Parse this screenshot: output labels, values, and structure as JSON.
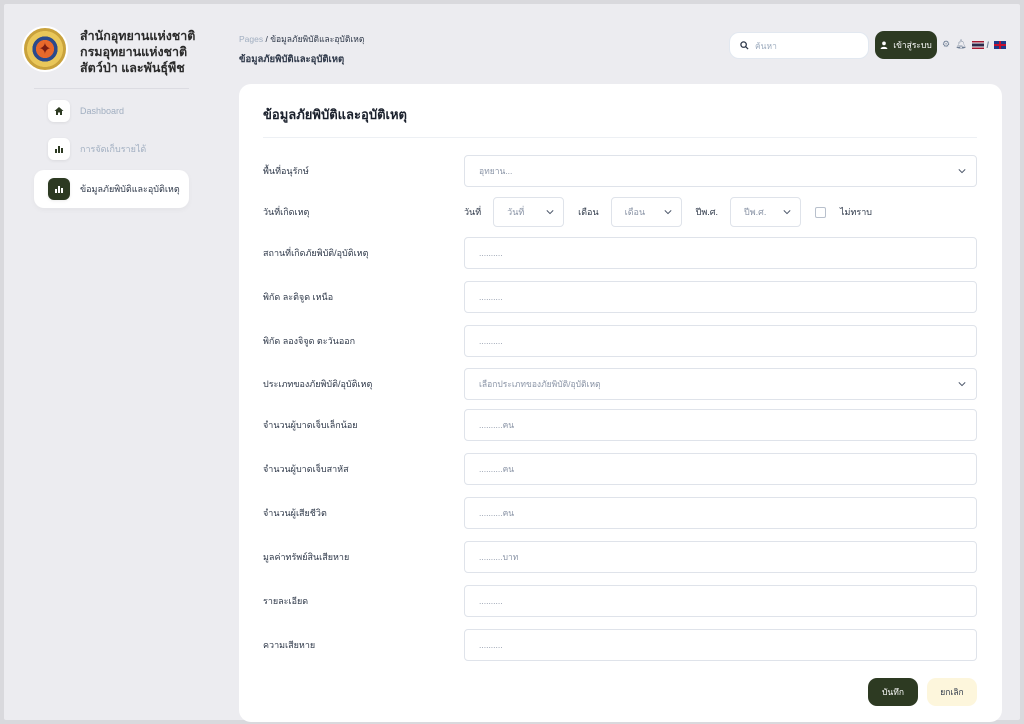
{
  "brand": {
    "logo_icon": "dept-seal-icon",
    "lines": [
      "สำนักอุทยานแห่งชาติ",
      "กรมอุทยานแห่งชาติ",
      "สัตว์ป่า และพันธุ์พืช"
    ]
  },
  "sidebar": {
    "items": [
      {
        "label": "Dashboard",
        "icon": "home-icon",
        "active": false
      },
      {
        "label": "การจัดเก็บรายได้",
        "icon": "bar-chart-icon",
        "active": false
      },
      {
        "label": "ข้อมูลภัยพิบัติและอุบัติเหตุ",
        "icon": "bar-chart-icon",
        "active": true
      }
    ]
  },
  "header": {
    "breadcrumb_root": "Pages",
    "breadcrumb_sep": "/",
    "breadcrumb_current": "ข้อมูลภัยพิบัติและอุบัติเหตุ",
    "page_title": "ข้อมูลภัยพิบัติและอุบัติเหตุ",
    "search_placeholder": "ค้นหา",
    "login_label": "เข้าสู่ระบบ",
    "lang_sep": "/"
  },
  "form": {
    "title": "ข้อมูลภัยพิบัติและอุบัติเหตุ",
    "park": {
      "label": "พื้นที่อนุรักษ์",
      "placeholder": "อุทยาน..."
    },
    "date": {
      "label": "วันที่เกิดเหตุ",
      "day_label": "วันที่",
      "day_value": "วันที่",
      "month_label": "เดือน",
      "month_value": "เดือน",
      "year_label": "ปีพ.ศ.",
      "year_value": "ปีพ.ศ.",
      "unknown_label": "ไม่ทราบ"
    },
    "location": {
      "label": "สถานที่เกิดภัยพิบัติ/อุบัติเหตุ",
      "placeholder": ".........."
    },
    "latitude": {
      "label": "พิกัด ละติจูด เหนือ",
      "placeholder": ".........."
    },
    "longitude": {
      "label": "พิกัด ลองจิจูด ตะวันออก",
      "placeholder": ".........."
    },
    "type": {
      "label": "ประเภทของภัยพิบัติ/อุบัติเหตุ",
      "placeholder": "เลือกประเภทของภัยพิบัติ/อุบัติเหตุ"
    },
    "minor_injured": {
      "label": "จำนวนผู้บาดเจ็บเล็กน้อย",
      "placeholder": "..........คน"
    },
    "serious_injured": {
      "label": "จำนวนผู้บาดเจ็บสาหัส",
      "placeholder": "..........คน"
    },
    "deaths": {
      "label": "จำนวนผู้เสียชีวิต",
      "placeholder": "..........คน"
    },
    "property_loss": {
      "label": "มูลค่าทรัพย์สินเสียหาย",
      "placeholder": "..........บาท"
    },
    "details": {
      "label": "รายละเอียด",
      "placeholder": ".........."
    },
    "damage": {
      "label": "ความเสียหาย",
      "placeholder": ".........."
    },
    "save_label": "บันทึก",
    "cancel_label": "ยกเลิก"
  },
  "colors": {
    "accent": "#2d3a22",
    "cancel_bg": "#fdf6dc",
    "page_bg": "#ececf0"
  }
}
